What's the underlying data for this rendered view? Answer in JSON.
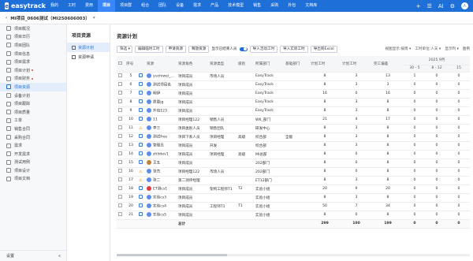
{
  "app": {
    "name": "easytrack",
    "logo_glyph": "e"
  },
  "nav": [
    "我的",
    "工时",
    "费用",
    "项目",
    "项目群",
    "组合",
    "团队",
    "设备",
    "需求",
    "产品",
    "技术模型",
    "销售",
    "采购",
    "外包",
    "文档库"
  ],
  "nav_active": 3,
  "top_icons": [
    "+",
    "☰",
    "AI",
    "⚙"
  ],
  "avatar": "人",
  "project": {
    "name": "MI项目_0606测试（MI250606003）"
  },
  "sidebar": {
    "items": [
      {
        "label": "项目概况",
        "dot": false
      },
      {
        "label": "项目日历",
        "dot": false
      },
      {
        "label": "项目团队",
        "dot": false
      },
      {
        "label": "项目信息",
        "dot": false
      },
      {
        "label": "项目需求",
        "dot": false
      },
      {
        "label": "项目计划",
        "dot": true
      },
      {
        "label": "项目财务",
        "dot": true
      },
      {
        "label": "项目资源",
        "dot": false
      },
      {
        "label": "设备计划",
        "dot": false
      },
      {
        "label": "项目跟踪",
        "dot": false
      },
      {
        "label": "项目质量",
        "dot": false
      },
      {
        "label": "工单",
        "dot": false
      },
      {
        "label": "销售合同",
        "dot": false
      },
      {
        "label": "采购合同",
        "dot": false
      },
      {
        "label": "需求",
        "dot": false
      },
      {
        "label": "开发需求",
        "dot": false
      },
      {
        "label": "测试用例",
        "dot": false
      },
      {
        "label": "项目设计",
        "dot": false
      },
      {
        "label": "项目文档",
        "dot": false
      }
    ],
    "active": 7,
    "footer": "设置",
    "collapse": "«"
  },
  "subnav": {
    "title": "项目资源",
    "items": [
      "资源计划",
      "资源申请"
    ],
    "active": 0
  },
  "main": {
    "title": "资源计划",
    "toolbar": {
      "select": "筛选 ▾",
      "buttons": [
        "编辑临时工时",
        "申请资源",
        "释放资源"
      ],
      "toggle_label": "显示已结束人员",
      "buttons2": [
        "导入活动工时",
        "导入实际工时",
        "导出到Excel"
      ],
      "right": [
        "视图显示:按周 ▾",
        "工时单位:人天 ▾",
        "显示列 ▾",
        "图例"
      ]
    },
    "columns": [
      "",
      "序号",
      "",
      "资源",
      "资源角色",
      "资源类型",
      "级别",
      "所属部门",
      "基础部门",
      "计划工时",
      "计划工时",
      "完工偏差",
      "2025 9月"
    ],
    "date_header": "2025 9月",
    "date_cols": [
      "30 - 5",
      "8 - 12",
      "15"
    ],
    "rows": [
      {
        "no": "5",
        "warn": false,
        "name": "yuchiwei_t...",
        "role": "项目成员",
        "type": "市场人员",
        "level": "",
        "dept": "EasyTrack",
        "base": "",
        "plan": "8",
        "act": "3",
        "dev": "13",
        "c1": "1",
        "c2": "0",
        "c3": "0",
        "color": "#5b8def"
      },
      {
        "no": "6",
        "warn": false,
        "name": "测试项目名",
        "role": "项目成员",
        "type": "",
        "level": "",
        "dept": "EasyTrack",
        "base": "",
        "plan": "8",
        "act": "3",
        "dev": "3",
        "c1": "0",
        "c2": "0",
        "c3": "0",
        "color": "#5b8def"
      },
      {
        "no": "7",
        "warn": false,
        "name": "明伊",
        "role": "项目成员",
        "type": "",
        "level": "",
        "dept": "EasyTrack",
        "base": "",
        "plan": "16",
        "act": "0",
        "dev": "16",
        "c1": "0",
        "c2": "0",
        "c3": "0",
        "color": "#5b8def"
      },
      {
        "no": "8",
        "warn": false,
        "name": "质量jg",
        "role": "项目成员",
        "type": "",
        "level": "",
        "dept": "EasyTrack",
        "base": "",
        "plan": "8",
        "act": "3",
        "dev": "8",
        "c1": "0",
        "c2": "0",
        "c3": "0",
        "color": "#5b8def"
      },
      {
        "no": "9",
        "warn": false,
        "name": "外包123",
        "role": "项目成员",
        "type": "",
        "level": "",
        "dept": "EasyTrack",
        "base": "",
        "plan": "8",
        "act": "3",
        "dev": "8",
        "c1": "0",
        "c2": "0",
        "c3": "0",
        "color": "#5b8def"
      },
      {
        "no": "10",
        "warn": false,
        "name": "11",
        "role": "项目经理122",
        "type": "销售人员",
        "level": "",
        "dept": "WK_部门",
        "base": "",
        "plan": "21",
        "act": "4",
        "dev": "17",
        "c1": "0",
        "c2": "0",
        "c3": "0",
        "color": "#5b8def"
      },
      {
        "no": "11",
        "warn": true,
        "name": "李三",
        "role": "项目类别人员",
        "type": "销售团队",
        "level": "",
        "dept": "研发中心",
        "base": "",
        "plan": "8",
        "act": "3",
        "dev": "8",
        "c1": "0",
        "c2": "0",
        "c3": "0",
        "color": "#5b8def"
      },
      {
        "no": "12",
        "warn": false,
        "name": "测试free",
        "role": "项目下系人员",
        "type": "项目经理",
        "level": "高级",
        "dept": "综合部",
        "base": "全能",
        "plan": "8",
        "act": "3",
        "dev": "8",
        "c1": "0",
        "c2": "0",
        "c3": "0",
        "color": "#5b8def"
      },
      {
        "no": "13",
        "warn": false,
        "name": "管理员",
        "role": "项目成员",
        "type": "开发",
        "level": "",
        "dept": "综合部",
        "base": "",
        "plan": "8",
        "act": "3",
        "dev": "8",
        "c1": "0",
        "c2": "0",
        "c3": "0",
        "color": "#5b8def"
      },
      {
        "no": "14",
        "warn": false,
        "name": "zhltdev1",
        "role": "项目成员",
        "type": "项目经理",
        "level": "高级",
        "dept": "MI总部",
        "base": "",
        "plan": "8",
        "act": "0",
        "dev": "8",
        "c1": "0",
        "c2": "0",
        "c3": "0",
        "color": "#5b8def"
      },
      {
        "no": "15",
        "warn": false,
        "name": "王五",
        "role": "项目成员",
        "type": "",
        "level": "",
        "dept": "202部门",
        "base": "",
        "plan": "8",
        "act": "0",
        "dev": "8",
        "c1": "0",
        "c2": "0",
        "c3": "0",
        "color": "#c0803a"
      },
      {
        "no": "16",
        "warn": true,
        "name": "张杰",
        "role": "项目经理122",
        "type": "市场人员",
        "level": "",
        "dept": "202部门",
        "base": "",
        "plan": "8",
        "act": "0",
        "dev": "8",
        "c1": "0",
        "c2": "0",
        "c3": "0",
        "color": "#5b8def"
      },
      {
        "no": "17",
        "warn": true,
        "name": "张二",
        "role": "第二测评经理",
        "type": "",
        "level": "",
        "dept": "ET12部门",
        "base": "",
        "plan": "8",
        "act": "3",
        "dev": "8",
        "c1": "0",
        "c2": "0",
        "c3": "0",
        "color": "#5b8def"
      },
      {
        "no": "18",
        "warn": false,
        "name": "ET测cs1",
        "role": "项目成员",
        "type": "架构工程师T1",
        "level": "T2",
        "dept": "实验小组",
        "base": "",
        "plan": "20",
        "act": "9",
        "dev": "20",
        "c1": "0",
        "c2": "0",
        "c3": "0",
        "color": "#e03a3a"
      },
      {
        "no": "19",
        "warn": false,
        "name": "实验cs3",
        "role": "项目成员",
        "type": "",
        "level": "",
        "dept": "实验小组",
        "base": "",
        "plan": "8",
        "act": "3",
        "dev": "8",
        "c1": "0",
        "c2": "0",
        "c3": "0",
        "color": "#5b8def"
      },
      {
        "no": "20",
        "warn": false,
        "name": "实验cs4",
        "role": "项目成员",
        "type": "工程师T1",
        "level": "T1",
        "dept": "实验小组",
        "base": "",
        "plan": "50",
        "act": "7",
        "dev": "34",
        "c1": "0",
        "c2": "0",
        "c3": "0",
        "color": "#5b8def"
      },
      {
        "no": "21",
        "warn": false,
        "name": "实验cs5",
        "role": "项目成员",
        "type": "",
        "level": "",
        "dept": "实验小组",
        "base": "",
        "plan": "8",
        "act": "0",
        "dev": "8",
        "c1": "0",
        "c2": "0",
        "c3": "0",
        "color": "#5b8def"
      }
    ],
    "total": {
      "label": "总计",
      "plan": "299",
      "act": "100",
      "dev": "199",
      "c1": "0",
      "c2": "0",
      "c3": "0"
    }
  }
}
